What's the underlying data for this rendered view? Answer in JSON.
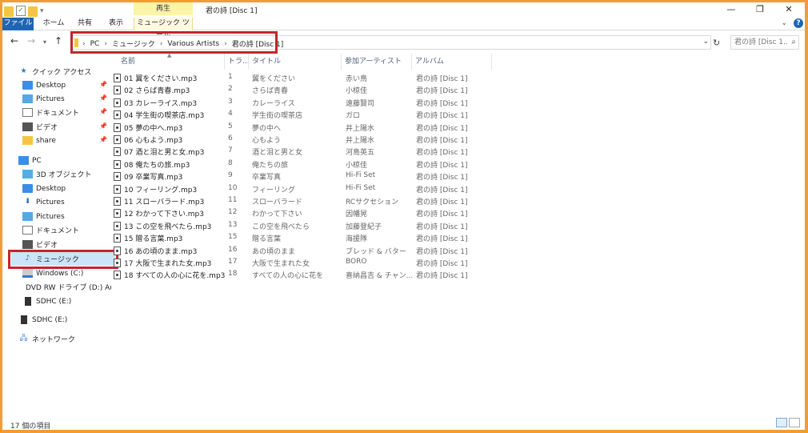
{
  "window": {
    "title": "君の詩 [Disc 1]",
    "context_tab_group": "再生",
    "controls": {
      "minimize": "—",
      "maximize": "❐",
      "close": "✕"
    }
  },
  "ribbon": {
    "tabs": [
      {
        "label": "ファイル"
      },
      {
        "label": "ホーム"
      },
      {
        "label": "共有"
      },
      {
        "label": "表示"
      },
      {
        "label": "ミュージック ツール"
      }
    ],
    "help": "?"
  },
  "address": {
    "crumbs": [
      "PC",
      "ミュージック",
      "Various Artists",
      "君の詩 [Disc 1]"
    ],
    "separator": "›",
    "search_placeholder": "君の詩 [Disc 1..."
  },
  "sidebar": {
    "items": [
      {
        "label": "クイック アクセス",
        "icon": "quick-access-star-icon",
        "pinned": false
      },
      {
        "label": "Desktop",
        "icon": "desktop-icon",
        "pinned": true
      },
      {
        "label": "Pictures",
        "icon": "pictures-icon",
        "pinned": true
      },
      {
        "label": "ドキュメント",
        "icon": "document-icon",
        "pinned": true
      },
      {
        "label": "ビデオ",
        "icon": "video-icon",
        "pinned": true
      },
      {
        "label": "share",
        "icon": "folder-icon",
        "pinned": true
      },
      {
        "label": "PC",
        "icon": "pc-icon",
        "pinned": false
      },
      {
        "label": "3D オブジェクト",
        "icon": "3d-objects-icon",
        "pinned": false
      },
      {
        "label": "Desktop",
        "icon": "desktop-icon",
        "pinned": false
      },
      {
        "label": "Pictures",
        "icon": "downloads-icon",
        "pinned": false
      },
      {
        "label": "Pictures",
        "icon": "pictures-icon",
        "pinned": false
      },
      {
        "label": "ドキュメント",
        "icon": "document-icon",
        "pinned": false
      },
      {
        "label": "ビデオ",
        "icon": "video-icon",
        "pinned": false
      },
      {
        "label": "ミュージック",
        "icon": "music-note-icon",
        "pinned": false,
        "selected": true
      },
      {
        "label": "Windows (C:)",
        "icon": "drive-icon",
        "pinned": false
      },
      {
        "label": "DVD RW ドライブ (D:) Aud",
        "icon": "dvd-drive-icon",
        "pinned": false
      },
      {
        "label": "SDHC (E:)",
        "icon": "sd-card-icon",
        "pinned": false
      },
      {
        "label": "SDHC (E:)",
        "icon": "sd-card-icon",
        "pinned": false
      },
      {
        "label": "ネットワーク",
        "icon": "network-icon",
        "pinned": false
      }
    ]
  },
  "columns": [
    {
      "label": "名前"
    },
    {
      "label": "トラ..."
    },
    {
      "label": "タイトル"
    },
    {
      "label": "参加アーティスト"
    },
    {
      "label": "アルバム"
    }
  ],
  "files": [
    {
      "name": "01 翼をください.mp3",
      "track": "1",
      "title": "翼をください",
      "artist": "赤い鳥",
      "album": "君の詩 [Disc 1]"
    },
    {
      "name": "02 さらば青春.mp3",
      "track": "2",
      "title": "さらば青春",
      "artist": "小椋佳",
      "album": "君の詩 [Disc 1]"
    },
    {
      "name": "03 カレーライス.mp3",
      "track": "3",
      "title": "カレーライス",
      "artist": "遠藤賢司",
      "album": "君の詩 [Disc 1]"
    },
    {
      "name": "04 学生街の喫茶店.mp3",
      "track": "4",
      "title": "学生街の喫茶店",
      "artist": "ガロ",
      "album": "君の詩 [Disc 1]"
    },
    {
      "name": "05 夢の中へ.mp3",
      "track": "5",
      "title": "夢の中へ",
      "artist": "井上陽水",
      "album": "君の詩 [Disc 1]"
    },
    {
      "name": "06 心もよう.mp3",
      "track": "6",
      "title": "心もよう",
      "artist": "井上陽水",
      "album": "君の詩 [Disc 1]"
    },
    {
      "name": "07 酒と泪と男と女.mp3",
      "track": "7",
      "title": "酒と泪と男と女",
      "artist": "河島英五",
      "album": "君の詩 [Disc 1]"
    },
    {
      "name": "08 俺たちの旅.mp3",
      "track": "8",
      "title": "俺たちの旅",
      "artist": "小椋佳",
      "album": "君の詩 [Disc 1]"
    },
    {
      "name": "09 卒業写真.mp3",
      "track": "9",
      "title": "卒業写真",
      "artist": "Hi-Fi Set",
      "album": "君の詩 [Disc 1]"
    },
    {
      "name": "10 フィーリング.mp3",
      "track": "10",
      "title": "フィーリング",
      "artist": "Hi-Fi Set",
      "album": "君の詩 [Disc 1]"
    },
    {
      "name": "11 スローバラード.mp3",
      "track": "11",
      "title": "スローバラード",
      "artist": "RCサクセション",
      "album": "君の詩 [Disc 1]"
    },
    {
      "name": "12 わかって下さい.mp3",
      "track": "12",
      "title": "わかって下さい",
      "artist": "因幡晃",
      "album": "君の詩 [Disc 1]"
    },
    {
      "name": "13 この空を飛べたら.mp3",
      "track": "13",
      "title": "この空を飛べたら",
      "artist": "加藤登紀子",
      "album": "君の詩 [Disc 1]"
    },
    {
      "name": "15 贈る言葉.mp3",
      "track": "15",
      "title": "贈る言葉",
      "artist": "海援隊",
      "album": "君の詩 [Disc 1]"
    },
    {
      "name": "16 あの頃のまま.mp3",
      "track": "16",
      "title": "あの頃のまま",
      "artist": "ブレッド & バター",
      "album": "君の詩 [Disc 1]"
    },
    {
      "name": "17 大阪で生まれた女.mp3",
      "track": "17",
      "title": "大阪で生まれた女",
      "artist": "BORO",
      "album": "君の詩 [Disc 1]"
    },
    {
      "name": "18 すべての人の心に花を.mp3",
      "track": "18",
      "title": "すべての人の心に花を",
      "artist": "喜納昌吉 & チャン...",
      "album": "君の詩 [Disc 1]"
    }
  ],
  "status": {
    "item_count": "17 個の項目"
  },
  "colors": {
    "accent": "#1e66b5",
    "highlight_border": "#c3262b",
    "context_tab": "#fff3a6",
    "selection": "#cce4f7",
    "frame": "#f39c32"
  }
}
